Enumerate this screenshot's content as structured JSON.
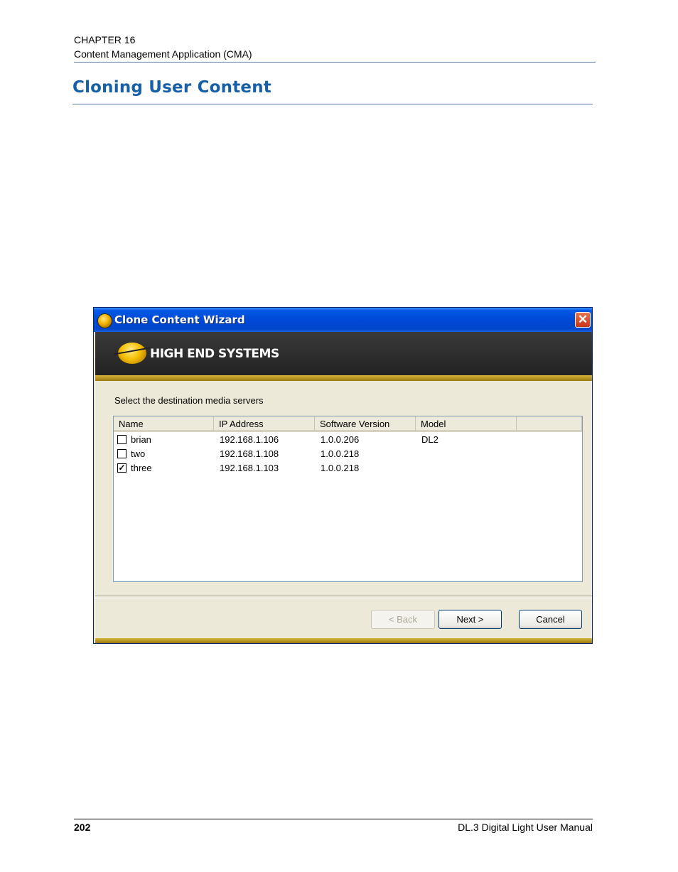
{
  "header": {
    "chapter": "CHAPTER 16",
    "chapter_title": "Content Management Application (CMA)",
    "section_title": "Cloning User Content"
  },
  "dialog": {
    "title": "Clone Content Wizard",
    "close_glyph": "✕",
    "brand": "HIGH END SYSTEMS",
    "instruction": "Select the destination media servers",
    "columns": [
      "Name",
      "IP Address",
      "Software Version",
      "Model"
    ],
    "rows": [
      {
        "checked": false,
        "name": "brian",
        "ip": "192.168.1.106",
        "version": "1.0.0.206",
        "model": "DL2"
      },
      {
        "checked": false,
        "name": "two",
        "ip": "192.168.1.108",
        "version": "1.0.0.218",
        "model": ""
      },
      {
        "checked": true,
        "name": "three",
        "ip": "192.168.1.103",
        "version": "1.0.0.218",
        "model": ""
      }
    ],
    "buttons": {
      "back": "< Back",
      "next": "Next >",
      "cancel": "Cancel"
    }
  },
  "footer": {
    "page_number": "202",
    "manual_name": "DL.3 Digital Light User Manual"
  },
  "icons": {
    "title_icon": "hes-logo-icon",
    "close": "close-icon",
    "checkbox_checked": "✓"
  }
}
